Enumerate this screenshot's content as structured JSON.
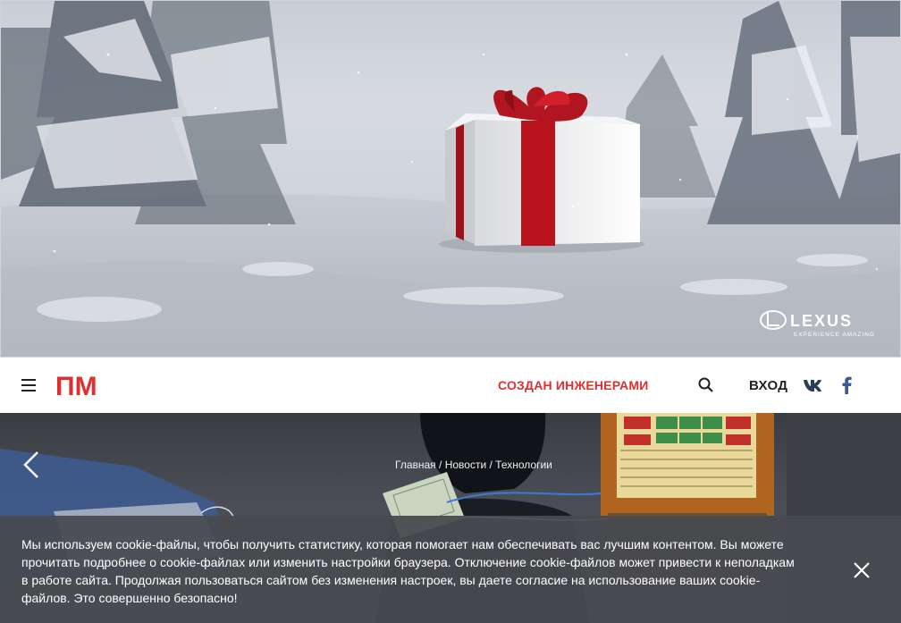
{
  "banner": {
    "advertiser_logo": "LEXUS",
    "advertiser_tagline": "EXPERIENCE AMAZING",
    "gift_icon": "gift-box-icon"
  },
  "header": {
    "menu_icon": "hamburger-menu-icon",
    "logo_text": "ПМ",
    "slogan": "СОЗДАН ИНЖЕНЕРАМИ",
    "search_icon": "search-icon",
    "login_label": "ВХОД",
    "social": [
      "vk-icon",
      "facebook-icon"
    ],
    "brand_color": "#e02f2f"
  },
  "hero": {
    "prev_icon": "chevron-left-icon",
    "breadcrumb": {
      "home": "Главная",
      "separator": " / ",
      "news": "Новости",
      "category": "Технологии"
    }
  },
  "cookie": {
    "text": "Мы используем cookie-файлы, чтобы получить статистику, которая помогает нам обеспечивать вас лучшим контентом. Вы можете прочитать подробнее о cookie-файлах или изменить настройки браузера. Отключение cookie-файлов может привести к неполадкам в работе сайта. Продолжая пользоваться сайтом без изменения настроек, вы даете согласие на использование ваших cookie-файлов. Это совершенно безопасно!",
    "close_icon": "close-icon"
  }
}
